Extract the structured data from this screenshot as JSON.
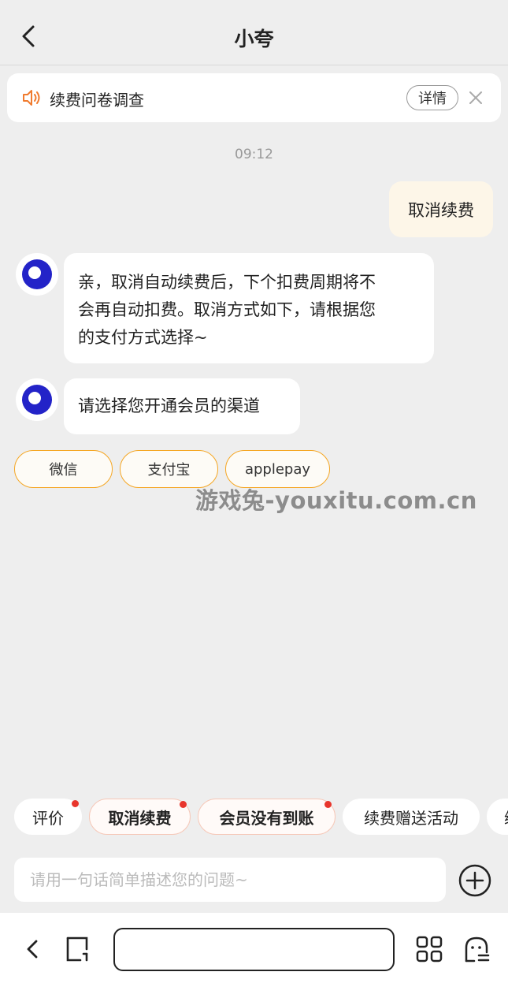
{
  "header": {
    "title": "小夸"
  },
  "notice": {
    "text": "续费问卷调查",
    "detail_label": "详情"
  },
  "chat": {
    "timestamp": "09:12",
    "user_message": "取消续费",
    "bot_message_1_lines": [
      "亲，取消自动续费后，下个扣费周期将不",
      "会再自动扣费。取消方式如下，请根据您",
      "的支付方式选择~"
    ],
    "bot_message_2": "请选择您开通会员的渠道",
    "options": [
      "微信",
      "支付宝",
      "applepay"
    ]
  },
  "watermark": "游戏兔-youxitu.com.cn",
  "quick_chips": [
    "评价",
    "取消续费",
    "会员没有到账",
    "续费赠送活动",
    "续"
  ],
  "input": {
    "placeholder": "请用一句话简单描述您的问题~"
  },
  "colors": {
    "accent_orange": "#f5a623",
    "avatar_blue": "#2323c8",
    "badge_red": "#e8352c"
  }
}
